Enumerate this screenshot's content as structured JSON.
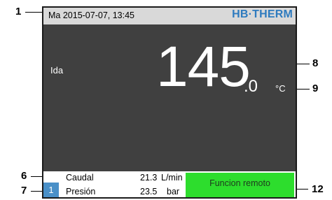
{
  "callouts": {
    "c1": "1",
    "c6": "6",
    "c7": "7",
    "c8": "8",
    "c9": "9",
    "c12": "12"
  },
  "status_bar": {
    "datetime": "Ma  2015-07-07, 13:45",
    "brand": "HB·THERM",
    "brand_color": "#2e7bbf",
    "background": "#d9d9d9"
  },
  "main_display": {
    "label": "Ida",
    "value_integer": "145",
    "value_decimal": ".0",
    "unit": "°C",
    "background": "#404040"
  },
  "bottom_bar": {
    "page_number": "1",
    "page_badge_color": "#4a90c8",
    "rows": [
      {
        "label": "Caudal",
        "value": "21.3",
        "unit": "L/min"
      },
      {
        "label": "Presión",
        "value": "23.5",
        "unit": "bar"
      }
    ],
    "remote_button": {
      "label": "Funcion  remoto",
      "color": "#2ddd2d"
    }
  }
}
